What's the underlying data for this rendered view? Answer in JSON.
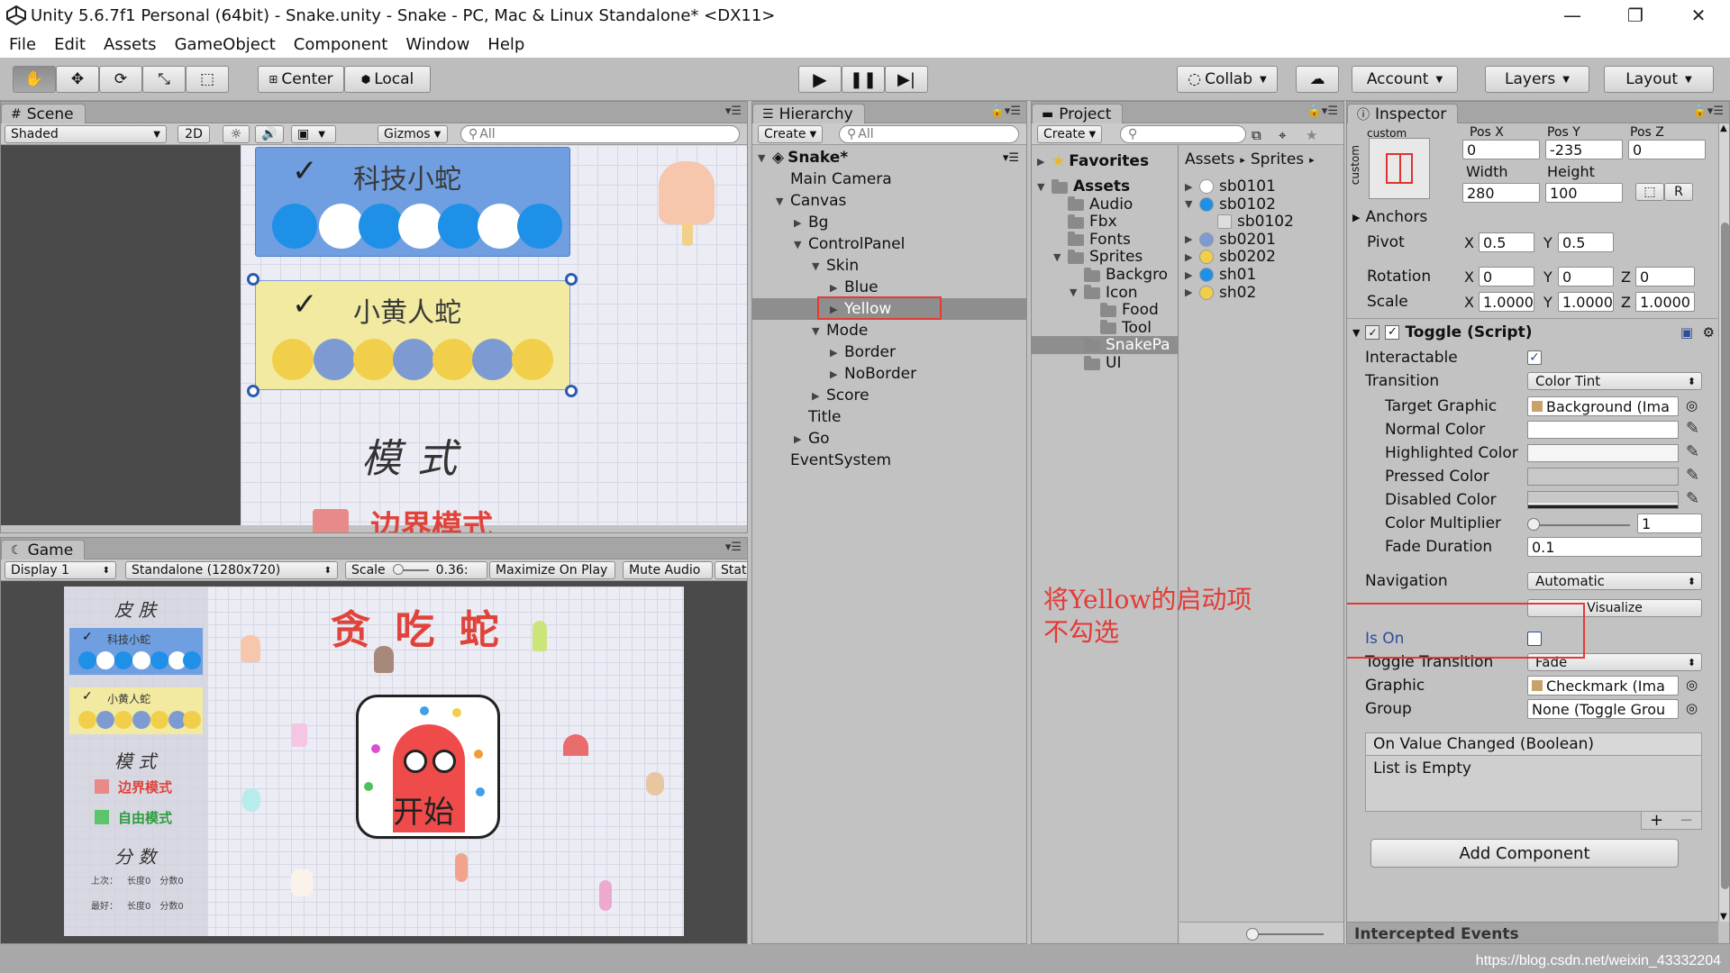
{
  "window": {
    "title": "Unity 5.6.7f1 Personal (64bit) - Snake.unity - Snake - PC, Mac & Linux Standalone* <DX11>"
  },
  "menu": [
    "File",
    "Edit",
    "Assets",
    "GameObject",
    "Component",
    "Window",
    "Help"
  ],
  "toolbar": {
    "pivot_center": "Center",
    "pivot_local": "Local",
    "collab": "Collab",
    "account": "Account",
    "layers": "Layers",
    "layout": "Layout"
  },
  "scene": {
    "tab": "Scene",
    "shading": "Shaded",
    "mode_2d": "2D",
    "gizmos": "Gizmos",
    "search_placeholder": "All",
    "skin1_label": "科技小蛇",
    "skin2_label": "小黄人蛇",
    "mode_label": "模式",
    "border_mode_label": "边界模式"
  },
  "game": {
    "tab": "Game",
    "display": "Display 1",
    "resolution": "Standalone (1280x720)",
    "scale_label": "Scale",
    "scale_value": "0.36:",
    "maximize": "Maximize On Play",
    "mute": "Mute Audio",
    "stats": "Stat",
    "title": "贪 吃 蛇",
    "skin_heading": "皮 肤",
    "skin1_label": "科技小蛇",
    "skin2_label": "小黄人蛇",
    "mode_heading": "模 式",
    "border_mode": "边界模式",
    "free_mode": "自由模式",
    "score_heading": "分 数",
    "score_row1": [
      "上次：",
      "长度0",
      "分数0"
    ],
    "score_row2": [
      "最好：",
      "长度0",
      "分数0"
    ],
    "start_label": "开始"
  },
  "hierarchy": {
    "tab": "Hierarchy",
    "create": "Create",
    "search_placeholder": "All",
    "scene_name": "Snake*",
    "items": [
      {
        "label": "Main Camera",
        "indent": 1,
        "arrow": ""
      },
      {
        "label": "Canvas",
        "indent": 1,
        "arrow": "open"
      },
      {
        "label": "Bg",
        "indent": 2,
        "arrow": "closed"
      },
      {
        "label": "ControlPanel",
        "indent": 2,
        "arrow": "open"
      },
      {
        "label": "Skin",
        "indent": 3,
        "arrow": "open"
      },
      {
        "label": "Blue",
        "indent": 4,
        "arrow": "closed"
      },
      {
        "label": "Yellow",
        "indent": 4,
        "arrow": "closed",
        "selected": true
      },
      {
        "label": "Mode",
        "indent": 3,
        "arrow": "open"
      },
      {
        "label": "Border",
        "indent": 4,
        "arrow": "closed"
      },
      {
        "label": "NoBorder",
        "indent": 4,
        "arrow": "closed"
      },
      {
        "label": "Score",
        "indent": 3,
        "arrow": "closed"
      },
      {
        "label": "Title",
        "indent": 2,
        "arrow": ""
      },
      {
        "label": "Go",
        "indent": 2,
        "arrow": "closed"
      },
      {
        "label": "EventSystem",
        "indent": 1,
        "arrow": ""
      }
    ]
  },
  "project": {
    "tab": "Project",
    "create": "Create",
    "favorites": "Favorites",
    "breadcrumb_assets": "Assets",
    "breadcrumb_sprites": "Sprites",
    "folders": [
      {
        "label": "Assets",
        "indent": 0,
        "arrow": "open",
        "bold": true
      },
      {
        "label": "Audio",
        "indent": 1,
        "arrow": ""
      },
      {
        "label": "Fbx",
        "indent": 1,
        "arrow": ""
      },
      {
        "label": "Fonts",
        "indent": 1,
        "arrow": ""
      },
      {
        "label": "Sprites",
        "indent": 1,
        "arrow": "open"
      },
      {
        "label": "Backgro",
        "indent": 2,
        "arrow": ""
      },
      {
        "label": "Icon",
        "indent": 2,
        "arrow": "open"
      },
      {
        "label": "Food",
        "indent": 3,
        "arrow": ""
      },
      {
        "label": "Tool",
        "indent": 3,
        "arrow": ""
      },
      {
        "label": "SnakePa",
        "indent": 2,
        "arrow": "",
        "selected": true
      },
      {
        "label": "UI",
        "indent": 2,
        "arrow": ""
      }
    ],
    "assets": [
      {
        "label": "sb0101",
        "arrow": "closed",
        "color": "#ffffff"
      },
      {
        "label": "sb0102",
        "arrow": "open",
        "color": "#1e90e8"
      },
      {
        "label": "sb0102",
        "arrow": "",
        "color": "#dddddd",
        "child": true
      },
      {
        "label": "sb0201",
        "arrow": "closed",
        "color": "#7d9bd2"
      },
      {
        "label": "sb0202",
        "arrow": "closed",
        "color": "#f2cf4a"
      },
      {
        "label": "sh01",
        "arrow": "closed",
        "color": "#1e90e8"
      },
      {
        "label": "sh02",
        "arrow": "closed",
        "color": "#f2cf4a"
      }
    ]
  },
  "inspector": {
    "tab": "Inspector",
    "anchor_preset": "custom",
    "posx_label": "Pos X",
    "posy_label": "Pos Y",
    "posz_label": "Pos Z",
    "posx": "0",
    "posy": "-235",
    "posz": "0",
    "width_label": "Width",
    "height_label": "Height",
    "width": "280",
    "height": "100",
    "r_button": "R",
    "anchors": "Anchors",
    "pivot": "Pivot",
    "pivot_x": "0.5",
    "pivot_y": "0.5",
    "rotation": "Rotation",
    "rot_x": "0",
    "rot_y": "0",
    "rot_z": "0",
    "scale": "Scale",
    "scale_x": "1.0000",
    "scale_y": "1.0000",
    "scale_z": "1.0000",
    "component": "Toggle (Script)",
    "interactable": "Interactable",
    "transition": "Transition",
    "transition_value": "Color Tint",
    "target_graphic": "Target Graphic",
    "target_graphic_value": "Background (Ima",
    "normal_color": "Normal Color",
    "highlighted_color": "Highlighted Color",
    "pressed_color": "Pressed Color",
    "disabled_color": "Disabled Color",
    "color_multiplier": "Color Multiplier",
    "color_multiplier_value": "1",
    "fade_duration": "Fade Duration",
    "fade_duration_value": "0.1",
    "navigation": "Navigation",
    "navigation_value": "Automatic",
    "visualize": "Visualize",
    "is_on": "Is On",
    "toggle_transition": "Toggle Transition",
    "toggle_transition_value": "Fade",
    "graphic": "Graphic",
    "graphic_value": "Checkmark (Ima",
    "group": "Group",
    "group_value": "None (Toggle Grou",
    "event_header": "On Value Changed (Boolean)",
    "event_empty": "List is Empty",
    "add_component": "Add Component",
    "intercepted": "Intercepted Events"
  },
  "annotation": {
    "line1": "将Yellow的启动项",
    "line2": "不勾选"
  },
  "watermark": "https://blog.csdn.net/weixin_43332204"
}
